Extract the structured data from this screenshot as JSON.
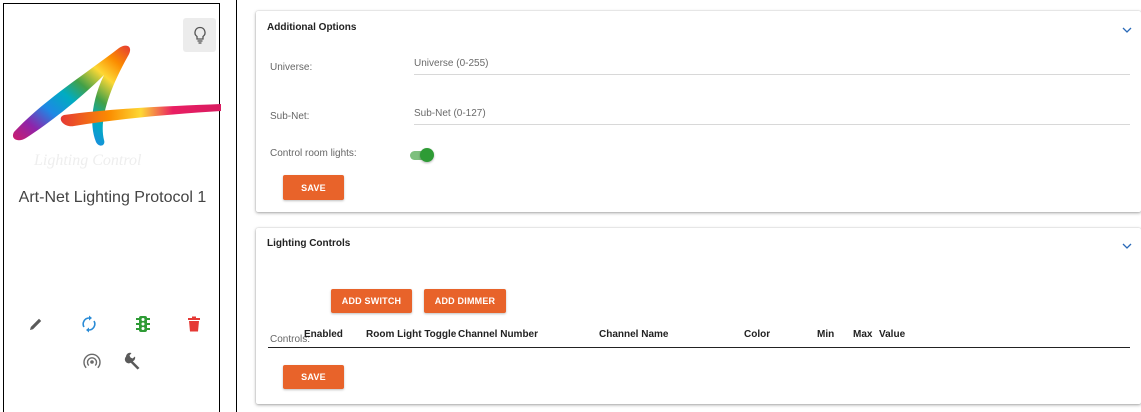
{
  "device": {
    "title": "Art-Net Lighting Protocol 1",
    "logo_icon": "art-net-rainbow-logo",
    "actions": [
      {
        "name": "edit-icon",
        "color": "#5a5a5a"
      },
      {
        "name": "sync-icon",
        "color": "#2a8bd6"
      },
      {
        "name": "traffic-light-icon",
        "color": "#2e9b35"
      },
      {
        "name": "delete-icon",
        "color": "#e53935"
      },
      {
        "name": "broadcast-icon",
        "color": "#6a6a6a"
      },
      {
        "name": "wrench-icon",
        "color": "#5a5a5a"
      }
    ]
  },
  "additional_options": {
    "header": "Additional Options",
    "universe_label": "Universe:",
    "universe_placeholder": "Universe (0-255)",
    "subnet_label": "Sub-Net:",
    "subnet_placeholder": "Sub-Net (0-127)",
    "room_lights_label": "Control room lights:",
    "room_lights_enabled": true,
    "save_label": "SAVE"
  },
  "lighting_controls": {
    "header": "Lighting Controls",
    "controls_label": "Controls:",
    "add_switch_label": "ADD SWITCH",
    "add_dimmer_label": "ADD DIMMER",
    "columns": [
      "Enabled",
      "Room Light Toggle",
      "Channel Number",
      "Channel Name",
      "Color",
      "Min",
      "Max",
      "Value"
    ],
    "save_label": "SAVE"
  },
  "colors": {
    "accent": "#e8632a",
    "toggle_on": "#2e9b35"
  }
}
